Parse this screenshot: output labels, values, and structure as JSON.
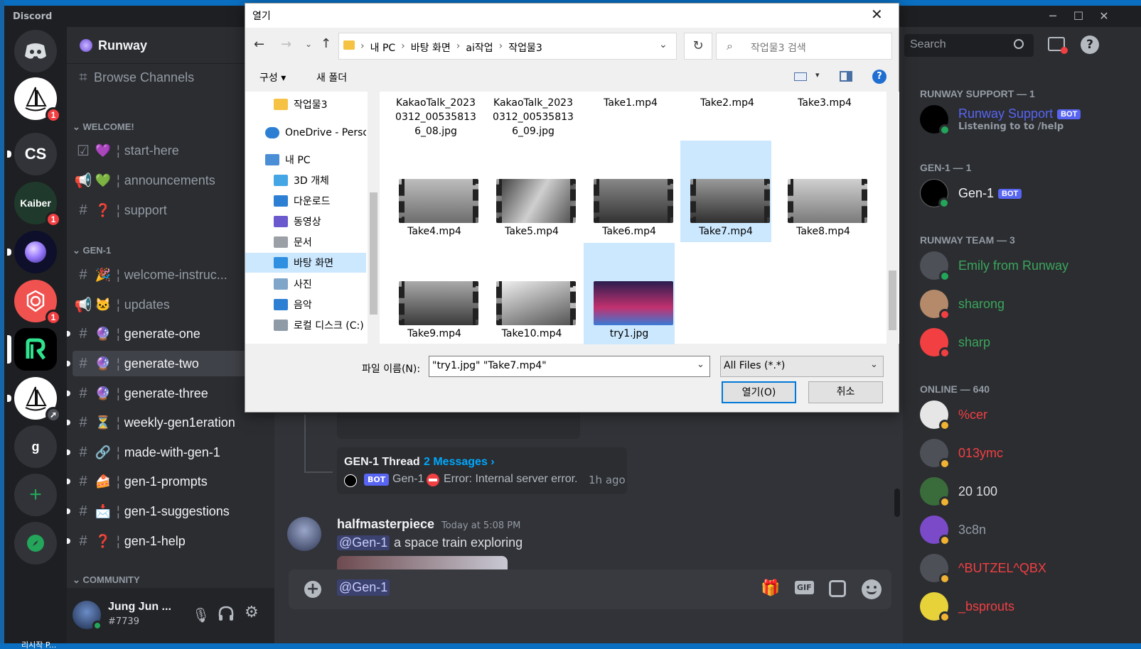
{
  "app": {
    "name": "Discord",
    "window_buttons": [
      "─",
      "☐",
      "✕"
    ]
  },
  "guilds": [
    {
      "icon": "sailboat-icon",
      "bg": "#ffffff",
      "badge": "1"
    },
    {
      "label": "CS",
      "bg": "#313338",
      "badge": ""
    },
    {
      "label": "Kaiber",
      "bg": "#1f3a2c",
      "badge": "1"
    },
    {
      "icon": "orb-icon",
      "bg": "#0e0f2a",
      "badge": ""
    },
    {
      "icon": "openai-icon",
      "bg": "#f0524f",
      "badge": "1"
    },
    {
      "icon": "runway-icon",
      "bg": "#000000",
      "badge": ""
    },
    {
      "icon": "sailboat-icon",
      "bg": "#ffffff",
      "badge": ""
    },
    {
      "label": "g",
      "bg": "#313338",
      "badge": ""
    }
  ],
  "server": {
    "name": "Runway",
    "browse": "Browse Channels"
  },
  "categories": {
    "welcome": "WELCOME!",
    "gen1": "GEN-1",
    "community": "COMMUNITY"
  },
  "channels": [
    {
      "name": "start-here",
      "emoji": "💜",
      "pre": "☑"
    },
    {
      "name": "announcements",
      "emoji": "💚",
      "pre": "📢"
    },
    {
      "name": "support",
      "emoji": "❓",
      "pre": "#"
    },
    {
      "name": "welcome-instruc...",
      "emoji": "🎉",
      "pre": "#"
    },
    {
      "name": "updates",
      "emoji": "🐱",
      "pre": "📢"
    },
    {
      "name": "generate-one",
      "emoji": "🔮",
      "pre": "#"
    },
    {
      "name": "generate-two",
      "emoji": "🔮",
      "pre": "#"
    },
    {
      "name": "generate-three",
      "emoji": "🔮",
      "pre": "#"
    },
    {
      "name": "weekly-gen1eration",
      "emoji": "⏳",
      "pre": "#"
    },
    {
      "name": "made-with-gen-1",
      "emoji": "🔗",
      "pre": "#"
    },
    {
      "name": "gen-1-prompts",
      "emoji": "🍰",
      "pre": "#"
    },
    {
      "name": "gen-1-suggestions",
      "emoji": "📩",
      "pre": "#"
    },
    {
      "name": "gen-1-help",
      "emoji": "❓",
      "pre": "#"
    }
  ],
  "user": {
    "name": "Jung Jun ...",
    "tag": "#7739"
  },
  "chat": {
    "thread_title": "GEN-1 Thread",
    "thread_count": "2 Messages ›",
    "thread_bot": "BOT",
    "thread_author": "Gen-1",
    "thread_error": "Error: Internal server error.",
    "thread_time": "1h ago",
    "msg_author": "halfmasterpiece",
    "msg_time": "Today at 5:08 PM",
    "msg_mention": "@Gen-1",
    "msg_text": "a space train exploring",
    "input_value": "@Gen-1"
  },
  "members": {
    "search_placeholder": "Search",
    "support_head": "RUNWAY SUPPORT — 1",
    "support_name": "Runway Support",
    "support_status": "Listening to to /help",
    "gen1_head": "GEN-1 — 1",
    "gen1_name": "Gen-1",
    "team_head": "RUNWAY TEAM — 3",
    "team": [
      "Emily from Runway",
      "sharong",
      "sharp"
    ],
    "online_head": "ONLINE — 640",
    "online": [
      "%cer",
      "013ymc",
      "20 100",
      "3c8n",
      "^BUTZEL^QBX",
      "_bsprouts"
    ],
    "bot_label": "BOT"
  },
  "dialog": {
    "title": "열기",
    "path": [
      "내 PC",
      "바탕 화면",
      "ai작업",
      "작업물3"
    ],
    "search_placeholder": "작업물3 검색",
    "organize": "구성 ▾",
    "new_folder": "새 폴더",
    "nav": [
      "작업물3",
      "OneDrive - Person",
      "내 PC",
      "3D 개체",
      "다운로드",
      "동영상",
      "문서",
      "바탕 화면",
      "사진",
      "음악",
      "로컬 디스크 (C:)"
    ],
    "top_files": [
      "KakaoTalk_20230312_005358136_08.jpg",
      "KakaoTalk_20230312_005358136_09.jpg",
      "Take1.mp4",
      "Take2.mp4",
      "Take3.mp4"
    ],
    "files": [
      "Take4.mp4",
      "Take5.mp4",
      "Take6.mp4",
      "Take7.mp4",
      "Take8.mp4",
      "Take9.mp4",
      "Take10.mp4",
      "try1.jpg"
    ],
    "filename_label": "파일 이름(N):",
    "filename_value": "\"try1.jpg\" \"Take7.mp4\"",
    "filter": "All Files (*.*)",
    "open": "열기(O)",
    "cancel": "취소"
  },
  "colors": {
    "accent": "#5865f2",
    "link": "#00a8fc",
    "online": "#23a55a",
    "dnd": "#f23f42",
    "idle": "#f0b232",
    "team": "#3ba55c",
    "member_red": "#f23f42"
  },
  "taskbar_text": "리시작 P..."
}
